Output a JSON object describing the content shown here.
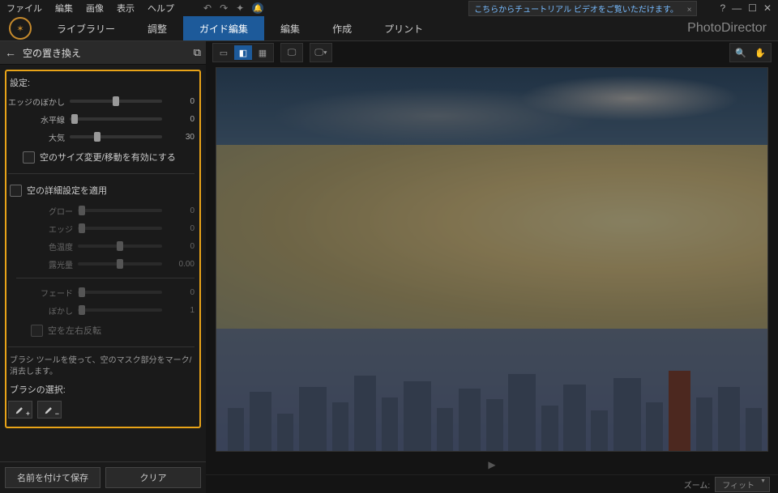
{
  "menu": {
    "file": "ファイル",
    "edit": "編集",
    "image": "画像",
    "view": "表示",
    "help": "ヘルプ"
  },
  "tutorial": {
    "text": "こちらからチュートリアル ビデオをご覧いただけます。",
    "close": "×"
  },
  "brand": "PhotoDirector",
  "tabs": {
    "library": "ライブラリー",
    "adjust": "調整",
    "guided": "ガイド編集",
    "edit": "編集",
    "create": "作成",
    "print": "プリント"
  },
  "panel": {
    "title": "空の置き換え"
  },
  "sliders": {
    "settings": "設定:",
    "edge_blur": {
      "label": "エッジのぼかし",
      "value": "0",
      "pos": 50
    },
    "horizon": {
      "label": "水平線",
      "value": "0",
      "pos": 5
    },
    "atmosphere": {
      "label": "大気",
      "value": "30",
      "pos": 30
    },
    "enable_resize": "空のサイズ変更/移動を有効にする",
    "apply_detail": "空の詳細設定を適用",
    "glow": {
      "label": "グロー",
      "value": "0",
      "pos": 5
    },
    "edge": {
      "label": "エッジ",
      "value": "0",
      "pos": 5
    },
    "temp": {
      "label": "色温度",
      "value": "0",
      "pos": 50
    },
    "exposure": {
      "label": "露光量",
      "value": "0.00",
      "pos": 50
    },
    "fade": {
      "label": "フェード",
      "value": "0",
      "pos": 5
    },
    "blur": {
      "label": "ぼかし",
      "value": "1",
      "pos": 5
    },
    "flip": "空を左右反転",
    "brush_desc": "ブラシ ツールを使って、空のマスク部分をマーク/消去します。",
    "brush_select": "ブラシの選択:"
  },
  "footer": {
    "save": "名前を付けて保存",
    "clear": "クリア"
  },
  "zoom": {
    "label": "ズーム:",
    "value": "フィット"
  }
}
